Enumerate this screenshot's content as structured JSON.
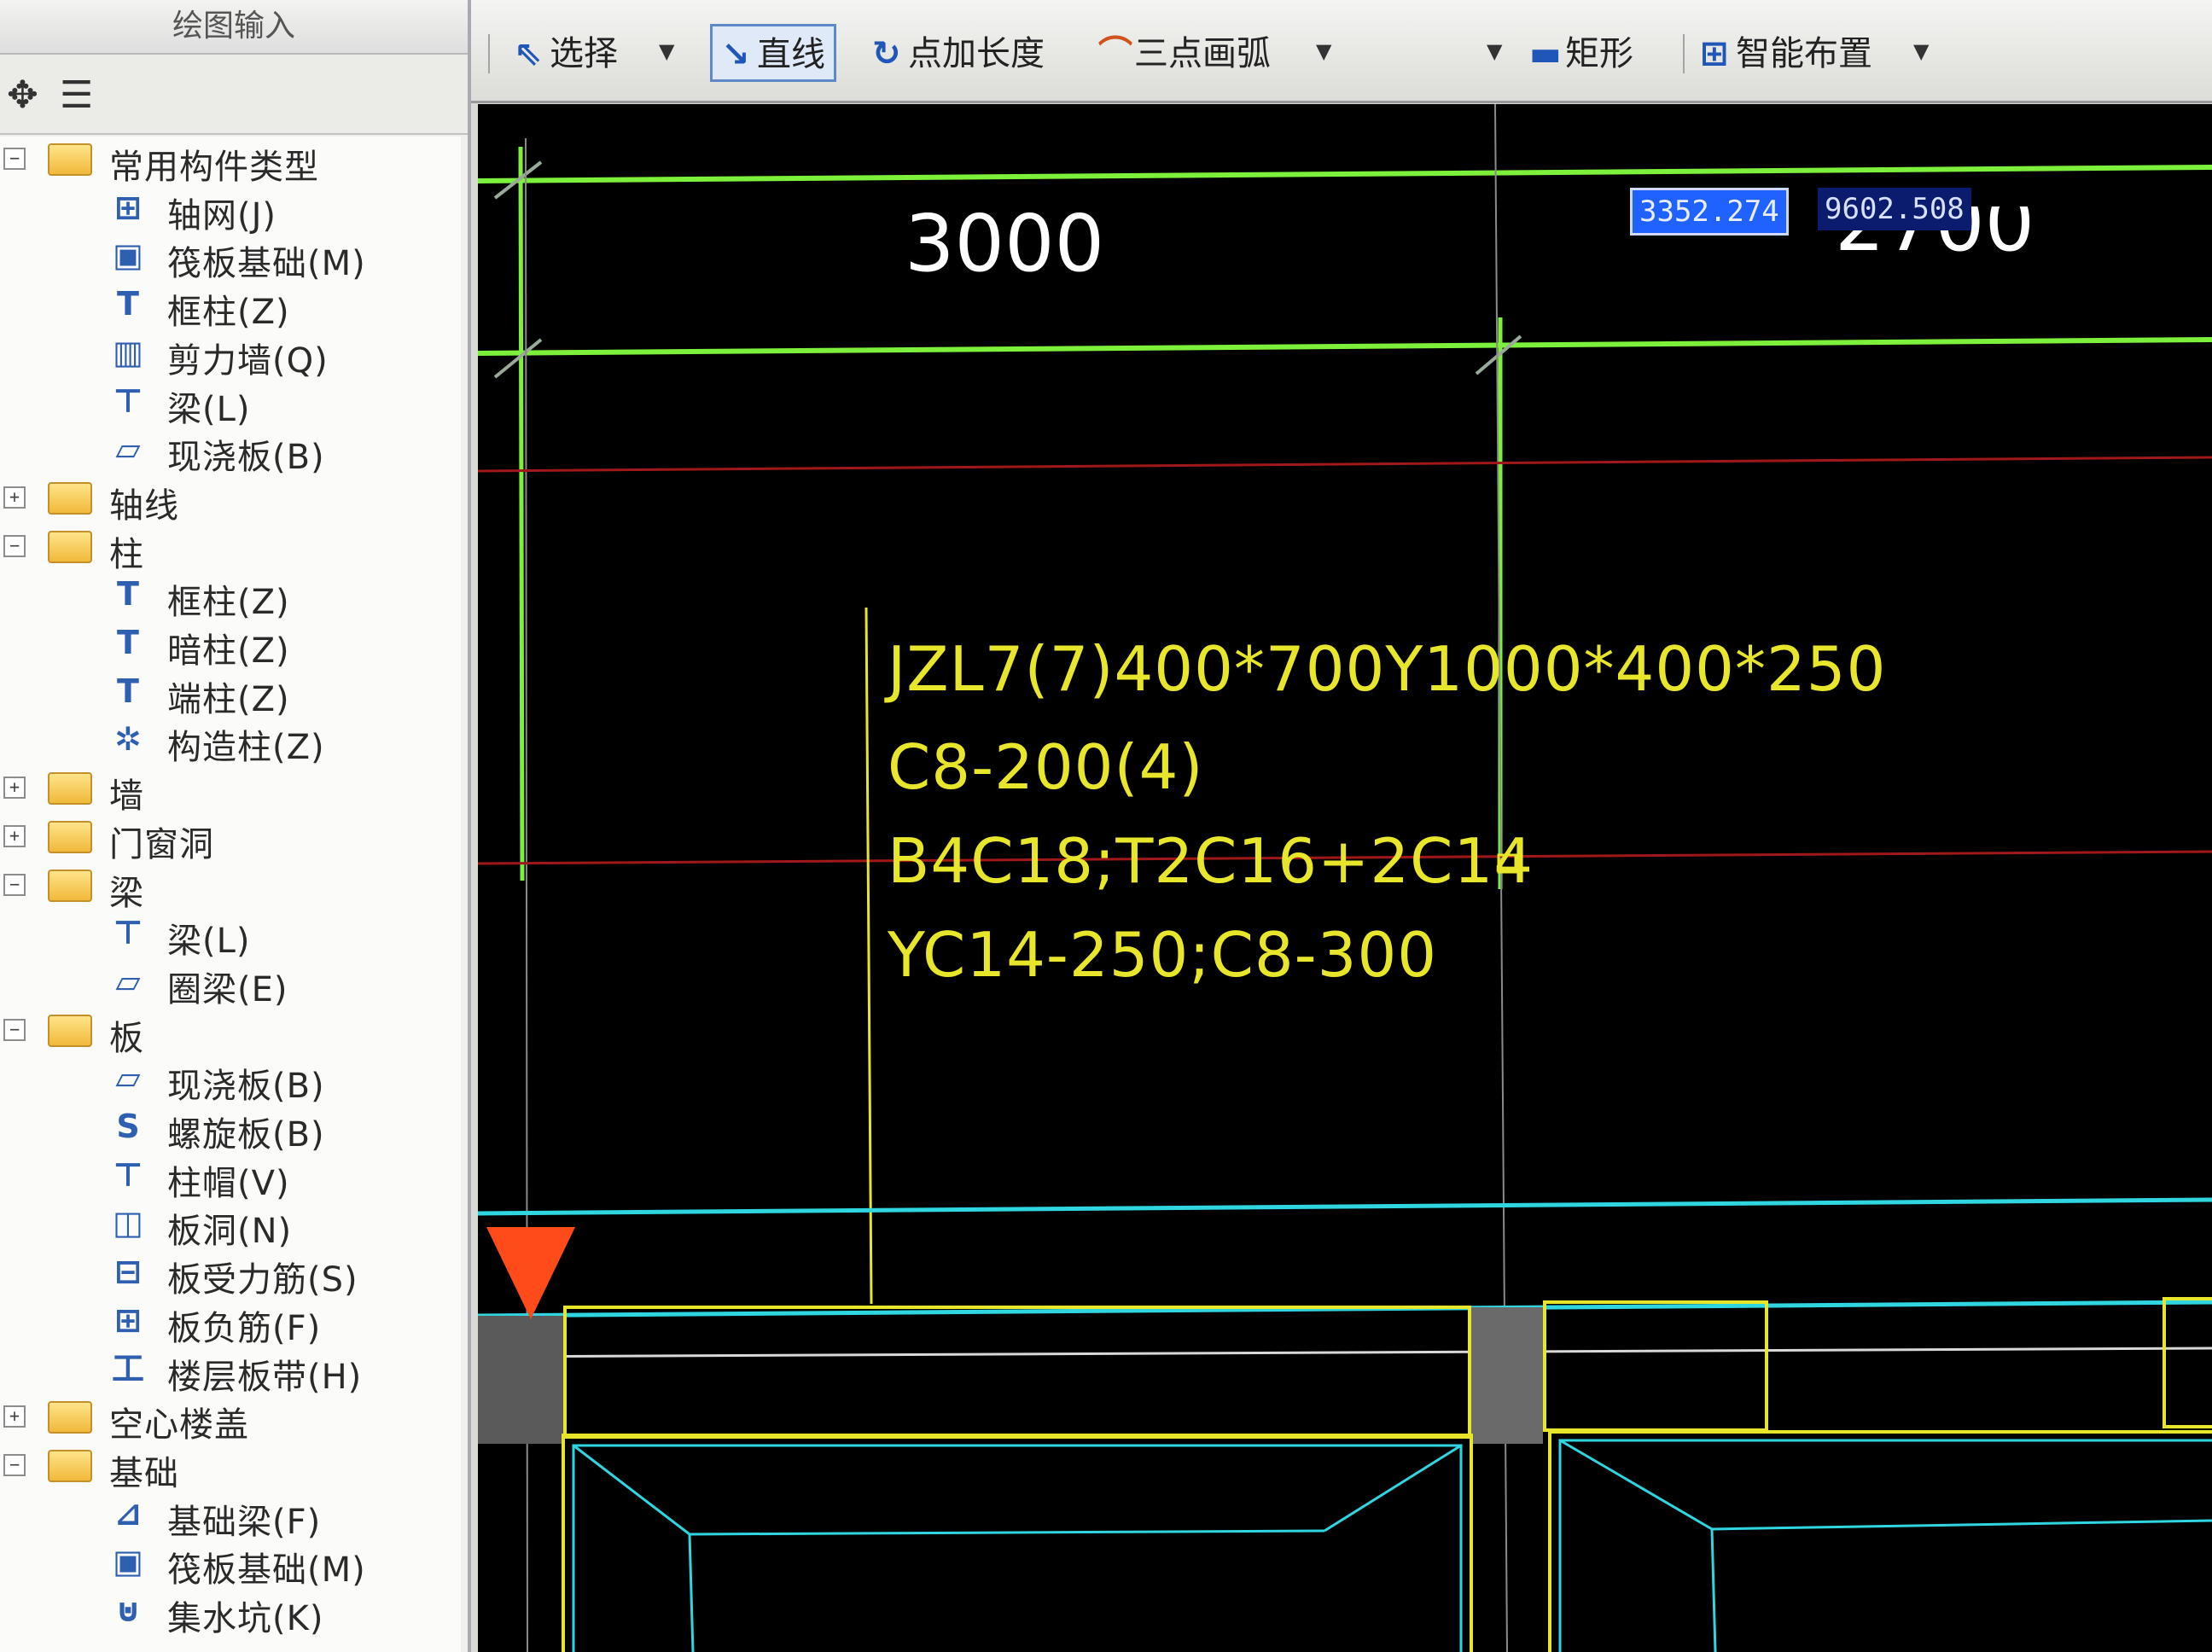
{
  "panel": {
    "title": "绘图输入",
    "tree": [
      {
        "level": 0,
        "expanded": true,
        "label": "常用构件类型"
      },
      {
        "level": 1,
        "icon": "grid-axis-icon",
        "label": "轴网(J)"
      },
      {
        "level": 1,
        "icon": "raft-foundation-icon",
        "label": "筏板基础(M)"
      },
      {
        "level": 1,
        "icon": "frame-column-icon",
        "label": "框柱(Z)"
      },
      {
        "level": 1,
        "icon": "shear-wall-icon",
        "label": "剪力墙(Q)"
      },
      {
        "level": 1,
        "icon": "beam-icon",
        "label": "梁(L)"
      },
      {
        "level": 1,
        "icon": "cast-slab-icon",
        "label": "现浇板(B)"
      },
      {
        "level": 0,
        "expanded": false,
        "label": "轴线"
      },
      {
        "level": 0,
        "expanded": true,
        "label": "柱"
      },
      {
        "level": 1,
        "icon": "frame-column-icon",
        "label": "框柱(Z)"
      },
      {
        "level": 1,
        "icon": "hidden-column-icon",
        "label": "暗柱(Z)"
      },
      {
        "level": 1,
        "icon": "end-column-icon",
        "label": "端柱(Z)"
      },
      {
        "level": 1,
        "icon": "structural-column-icon",
        "label": "构造柱(Z)"
      },
      {
        "level": 0,
        "expanded": false,
        "label": "墙"
      },
      {
        "level": 0,
        "expanded": false,
        "label": "门窗洞"
      },
      {
        "level": 0,
        "expanded": true,
        "label": "梁"
      },
      {
        "level": 1,
        "icon": "beam-icon",
        "label": "梁(L)"
      },
      {
        "level": 1,
        "icon": "ring-beam-icon",
        "label": "圈梁(E)"
      },
      {
        "level": 0,
        "expanded": true,
        "label": "板"
      },
      {
        "level": 1,
        "icon": "cast-slab-icon",
        "label": "现浇板(B)"
      },
      {
        "level": 1,
        "icon": "spiral-slab-icon",
        "label": "螺旋板(B)"
      },
      {
        "level": 1,
        "icon": "column-cap-icon",
        "label": "柱帽(V)"
      },
      {
        "level": 1,
        "icon": "slab-hole-icon",
        "label": "板洞(N)"
      },
      {
        "level": 1,
        "icon": "slab-rebar-icon",
        "label": "板受力筋(S)"
      },
      {
        "level": 1,
        "icon": "slab-negative-rebar-icon",
        "label": "板负筋(F)"
      },
      {
        "level": 1,
        "icon": "floor-slab-band-icon",
        "label": "楼层板带(H)"
      },
      {
        "level": 0,
        "expanded": false,
        "label": "空心楼盖"
      },
      {
        "level": 0,
        "expanded": true,
        "label": "基础"
      },
      {
        "level": 1,
        "icon": "foundation-beam-icon",
        "label": "基础梁(F)"
      },
      {
        "level": 1,
        "icon": "raft-foundation-icon",
        "label": "筏板基础(M)"
      },
      {
        "level": 1,
        "icon": "sump-pit-icon",
        "label": "集水坑(K)"
      }
    ]
  },
  "toolbar": {
    "select": "选择",
    "line": "直线",
    "point_length": "点加长度",
    "three_point_arc": "三点画弧",
    "rectangle": "矩形",
    "smart_layout": "智能布置"
  },
  "canvas": {
    "dim_left": "3000",
    "dim_right": "2700",
    "coord_x": "3352.274",
    "coord_y": "9602.508",
    "annotation": [
      "JZL7(7)400*700Y1000*400*250",
      "C8-200(4)",
      "B4C18;T2C16+2C14",
      "YC14-250;C8-300"
    ],
    "colors": {
      "background": "#000000",
      "axis_green": "#7cf03a",
      "annotation_yellow": "#e8e62a",
      "cyan": "#2fd6e0",
      "red_line": "#a01818",
      "marker": "#ff4a1a"
    }
  }
}
